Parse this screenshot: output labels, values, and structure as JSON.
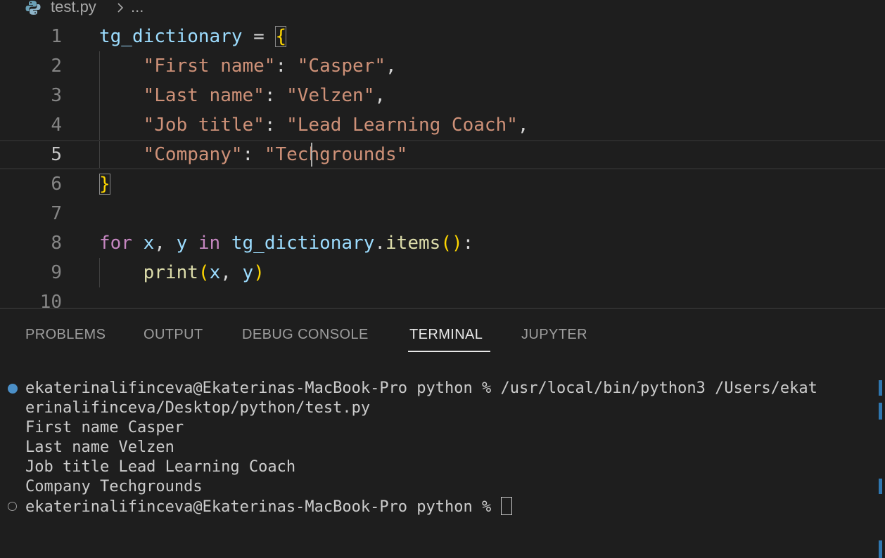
{
  "breadcrumb": {
    "file": "test.py",
    "separator": ">",
    "more": "..."
  },
  "editor": {
    "lines": [
      {
        "number": "1",
        "tokens": [
          {
            "t": "tg_dictionary",
            "c": "var"
          },
          {
            "t": " = ",
            "c": "op"
          },
          {
            "t": "{",
            "c": "brace"
          }
        ]
      },
      {
        "number": "2",
        "tokens": [
          {
            "t": "    ",
            "c": "op"
          },
          {
            "t": "\"First name\"",
            "c": "str"
          },
          {
            "t": ": ",
            "c": "op"
          },
          {
            "t": "\"Casper\"",
            "c": "str"
          },
          {
            "t": ",",
            "c": "op"
          }
        ]
      },
      {
        "number": "3",
        "tokens": [
          {
            "t": "    ",
            "c": "op"
          },
          {
            "t": "\"Last name\"",
            "c": "str"
          },
          {
            "t": ": ",
            "c": "op"
          },
          {
            "t": "\"Velzen\"",
            "c": "str"
          },
          {
            "t": ",",
            "c": "op"
          }
        ]
      },
      {
        "number": "4",
        "tokens": [
          {
            "t": "    ",
            "c": "op"
          },
          {
            "t": "\"Job title\"",
            "c": "str"
          },
          {
            "t": ": ",
            "c": "op"
          },
          {
            "t": "\"Lead Learning Coach\"",
            "c": "str"
          },
          {
            "t": ",",
            "c": "op"
          }
        ]
      },
      {
        "number": "5",
        "tokens": [
          {
            "t": "    ",
            "c": "op"
          },
          {
            "t": "\"Company\"",
            "c": "str"
          },
          {
            "t": ": ",
            "c": "op"
          },
          {
            "t": "\"Techgrounds\"",
            "c": "str"
          }
        ]
      },
      {
        "number": "6",
        "tokens": [
          {
            "t": "}",
            "c": "brace"
          }
        ]
      },
      {
        "number": "7",
        "tokens": []
      },
      {
        "number": "8",
        "tokens": [
          {
            "t": "for",
            "c": "kw"
          },
          {
            "t": " ",
            "c": "op"
          },
          {
            "t": "x",
            "c": "var"
          },
          {
            "t": ", ",
            "c": "op"
          },
          {
            "t": "y",
            "c": "var"
          },
          {
            "t": " ",
            "c": "op"
          },
          {
            "t": "in",
            "c": "kw"
          },
          {
            "t": " ",
            "c": "op"
          },
          {
            "t": "tg_dictionary",
            "c": "var"
          },
          {
            "t": ".",
            "c": "op"
          },
          {
            "t": "items",
            "c": "fn"
          },
          {
            "t": "()",
            "c": "brace"
          },
          {
            "t": ":",
            "c": "op"
          }
        ]
      },
      {
        "number": "9",
        "tokens": [
          {
            "t": "    ",
            "c": "op"
          },
          {
            "t": "print",
            "c": "fn"
          },
          {
            "t": "(",
            "c": "brace"
          },
          {
            "t": "x",
            "c": "var"
          },
          {
            "t": ", ",
            "c": "op"
          },
          {
            "t": "y",
            "c": "var"
          },
          {
            "t": ")",
            "c": "brace"
          }
        ]
      },
      {
        "number": "10",
        "tokens": []
      }
    ]
  },
  "panel": {
    "tabs": [
      {
        "label": "PROBLEMS"
      },
      {
        "label": "OUTPUT"
      },
      {
        "label": "DEBUG CONSOLE"
      },
      {
        "label": "TERMINAL"
      },
      {
        "label": "JUPYTER"
      }
    ]
  },
  "terminal": {
    "lines": [
      "ekaterinalifinceva@Ekaterinas-MacBook-Pro python % /usr/local/bin/python3 /Users/ekat",
      "erinalifinceva/Desktop/python/test.py",
      "First name Casper",
      "Last name Velzen",
      "Job title Lead Learning Coach",
      "Company Techgrounds"
    ],
    "prompt": "ekaterinalifinceva@Ekaterinas-MacBook-Pro python % "
  },
  "colors": {
    "background": "#1e1e1e",
    "variable": "#9cdcfe",
    "string": "#ce9178",
    "keyword": "#c586c0",
    "function": "#dcdcaa",
    "brace": "#ffd700",
    "terminal_dot": "#4b8fc7"
  }
}
